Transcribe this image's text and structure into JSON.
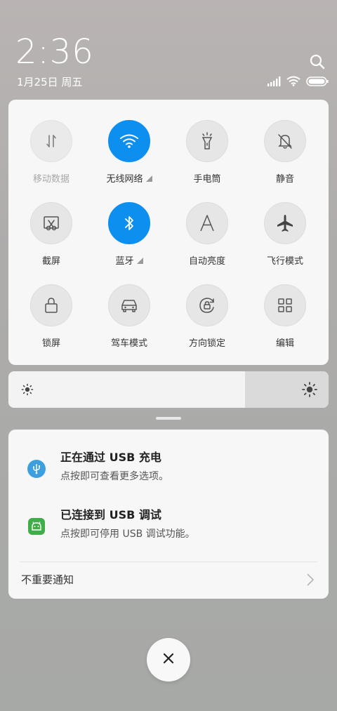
{
  "status": {
    "time": "2:36",
    "date": "1月25日 周五"
  },
  "quick_settings": [
    {
      "label": "移动数据",
      "icon": "mobile-data-icon",
      "active": false,
      "dim": true,
      "expand": false
    },
    {
      "label": "无线网络",
      "icon": "wifi-icon",
      "active": true,
      "dim": false,
      "expand": true
    },
    {
      "label": "手电筒",
      "icon": "flashlight-icon",
      "active": false,
      "dim": false,
      "expand": false
    },
    {
      "label": "静音",
      "icon": "bell-off-icon",
      "active": false,
      "dim": false,
      "expand": false
    },
    {
      "label": "截屏",
      "icon": "screenshot-icon",
      "active": false,
      "dim": false,
      "expand": false
    },
    {
      "label": "蓝牙",
      "icon": "bluetooth-icon",
      "active": true,
      "dim": false,
      "expand": true
    },
    {
      "label": "自动亮度",
      "icon": "auto-brightness-icon",
      "active": false,
      "dim": false,
      "expand": false
    },
    {
      "label": "飞行模式",
      "icon": "airplane-icon",
      "active": false,
      "dim": false,
      "expand": false
    },
    {
      "label": "锁屏",
      "icon": "lock-icon",
      "active": false,
      "dim": false,
      "expand": false
    },
    {
      "label": "驾车模式",
      "icon": "car-icon",
      "active": false,
      "dim": false,
      "expand": false
    },
    {
      "label": "方向锁定",
      "icon": "rotation-lock-icon",
      "active": false,
      "dim": false,
      "expand": false
    },
    {
      "label": "编辑",
      "icon": "grid-icon",
      "active": false,
      "dim": false,
      "expand": false
    }
  ],
  "brightness": {
    "level": 0.74
  },
  "notifications": [
    {
      "title": "正在通过 USB 充电",
      "text": "点按即可查看更多选项。",
      "icon": "usb-icon",
      "color": "#3b9fe0"
    },
    {
      "title": "已连接到 USB 调试",
      "text": "点按即可停用 USB 调试功能。",
      "icon": "android-icon",
      "color": "#3fae49"
    }
  ],
  "unimportant": {
    "label": "不重要通知"
  },
  "colors": {
    "accent": "#0d8ff0"
  }
}
